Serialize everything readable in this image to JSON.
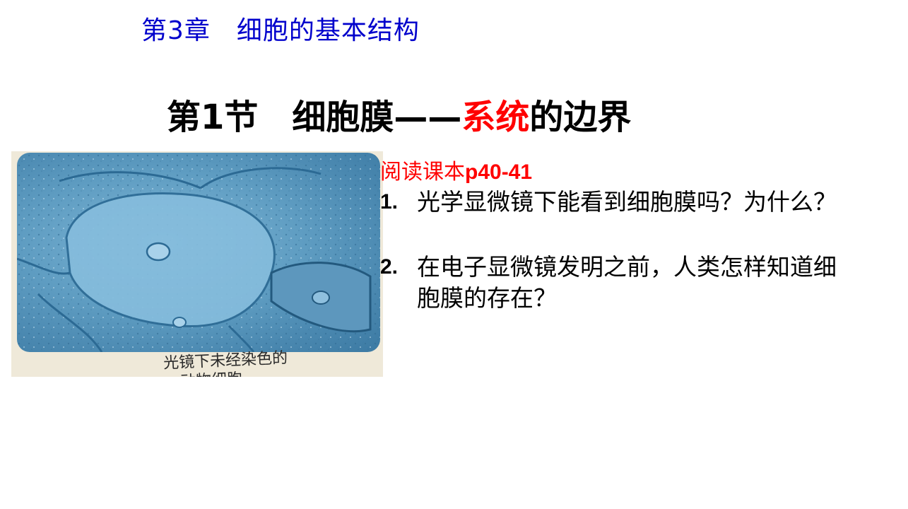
{
  "chapter_title": "第3章　细胞的基本结构",
  "section_title": {
    "part1": "第1节　细胞膜——",
    "highlight": "系统",
    "part2": "的边界"
  },
  "figure": {
    "caption_line1": "光镜下未经染色的",
    "caption_line2": "动物细胞"
  },
  "reading": {
    "prefix": "阅读课本",
    "pages": "p40-41"
  },
  "questions": [
    {
      "num": "1.",
      "text": "光学显微镜下能看到细胞膜吗？为什么？"
    },
    {
      "num": "2.",
      "text": "在电子显微镜发明之前，人类怎样知道细胞膜的存在？"
    }
  ],
  "colors": {
    "chapter": "#0000cc",
    "highlight": "#ff0000",
    "reading": "#ff0000"
  }
}
